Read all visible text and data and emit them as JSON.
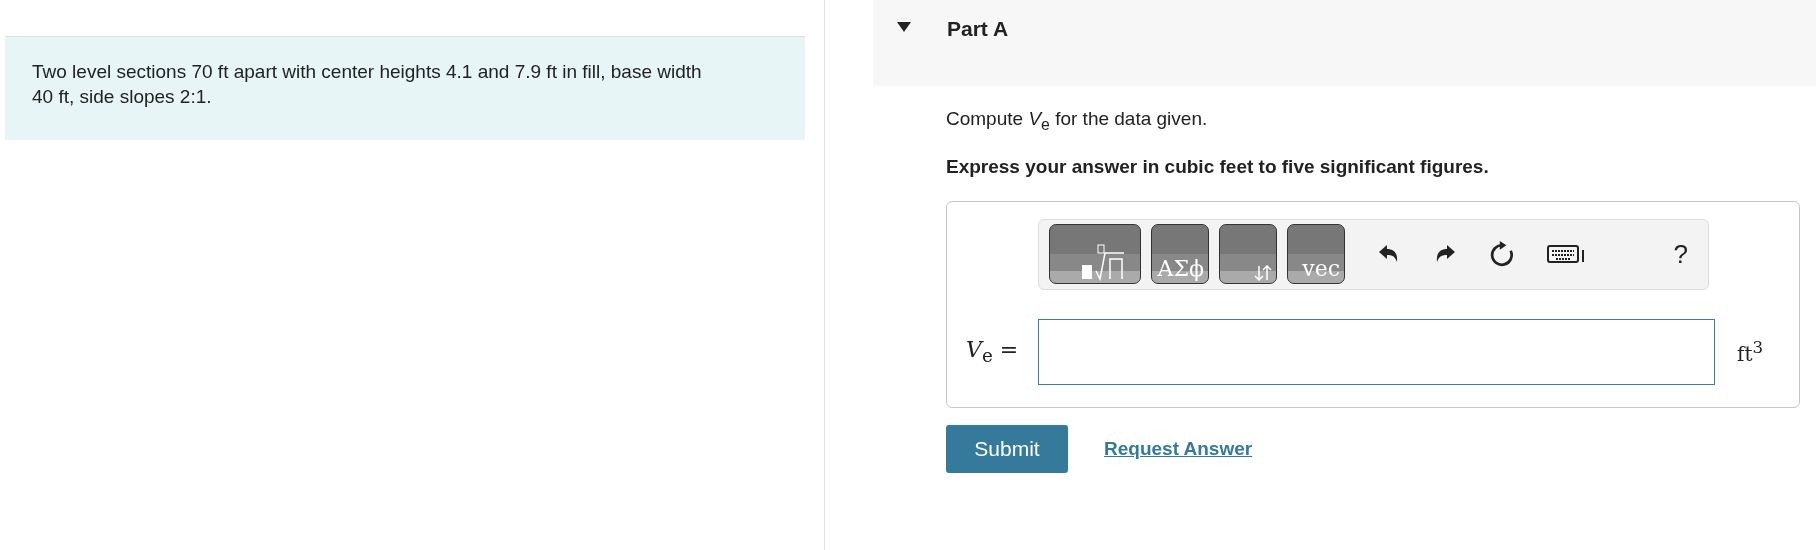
{
  "problem": {
    "text": "Two level sections 70 ft apart with center heights 4.1 and 7.9 ft in fill, base width 40 ft, side slopes 2:1."
  },
  "part": {
    "title": "Part A",
    "expanded": true,
    "prompt": "Compute *V*$_{e}$ for the data given.",
    "instruction": "Express your answer in cubic feet to five significant figures.",
    "toolbar": [
      {
        "kind": "template"
      },
      {
        "kind": "text",
        "label": "ΑΣϕ"
      },
      {
        "kind": "arrows"
      },
      {
        "kind": "text",
        "label": "vec"
      },
      {
        "kind": "undo"
      },
      {
        "kind": "redo"
      },
      {
        "kind": "reset"
      },
      {
        "kind": "keyboard"
      },
      {
        "kind": "help",
        "label": "?"
      }
    ],
    "answer": {
      "label": "*V*$_{e}$ =",
      "unit": "ft$^{3}$"
    },
    "buttons": [
      {
        "kind": "primary",
        "label": "Submit"
      },
      {
        "kind": "link",
        "label": "Request Answer"
      }
    ]
  }
}
